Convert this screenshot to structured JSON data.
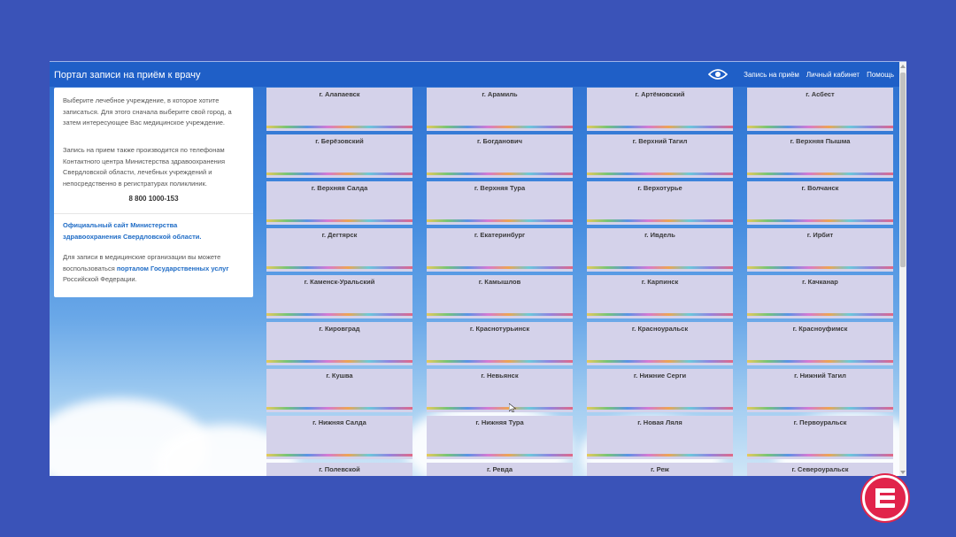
{
  "header": {
    "title": "Портал записи на приём к врачу",
    "icon": "eye-icon",
    "nav": [
      {
        "label": "Запись на приём"
      },
      {
        "label": "Личный кабинет"
      },
      {
        "label": "Помощь"
      }
    ]
  },
  "sidebar": {
    "intro": "Выберите лечебное учреждение, в которое хотите записаться. Для этого сначала выберите свой город, а затем интересующее Вас медицинское учреждение.",
    "phone_info": "Запись на прием также производится по телефонам Контактного центра Министерства здравоохранения Свердловской области, лечебных учреждений и непосредственно в регистратурах поликлиник.",
    "phone": "8 800 1000-153",
    "ministry_link": "Официальный сайт Министерства здравоохранения Свердловской области.",
    "gosuslugi_before": "Для записи в медицинские организации вы можете воспользоваться ",
    "gosuslugi_link": "порталом Государственных услуг",
    "gosuslugi_after": " Российской Федерации."
  },
  "cities": [
    "г. Алапаевск",
    "г. Арамиль",
    "г. Артёмовский",
    "г. Асбест",
    "г. Берёзовский",
    "г. Богданович",
    "г. Верхний Тагил",
    "г. Верхняя Пышма",
    "г. Верхняя Салда",
    "г. Верхняя Тура",
    "г. Верхотурье",
    "г. Волчанск",
    "г. Дегтярск",
    "г. Екатеринбург",
    "г. Ивдель",
    "г. Ирбит",
    "г. Каменск-Уральский",
    "г. Камышлов",
    "г. Карпинск",
    "г. Качканар",
    "г. Кировград",
    "г. Краснотурьинск",
    "г. Красноуральск",
    "г. Красноуфимск",
    "г. Кушва",
    "г. Невьянск",
    "г. Нижние Серги",
    "г. Нижний Тагил",
    "г. Нижняя Салда",
    "г. Нижняя Тура",
    "г. Новая Ляля",
    "г. Первоуральск",
    "г. Полевской",
    "г. Ревда",
    "г. Реж",
    "г. Североуральск"
  ],
  "colors": {
    "background": "#3a53b8",
    "header": "#1f5fc7",
    "card": "#d4d2ea",
    "link": "#1f6cc6",
    "logo": "#e1244b"
  }
}
